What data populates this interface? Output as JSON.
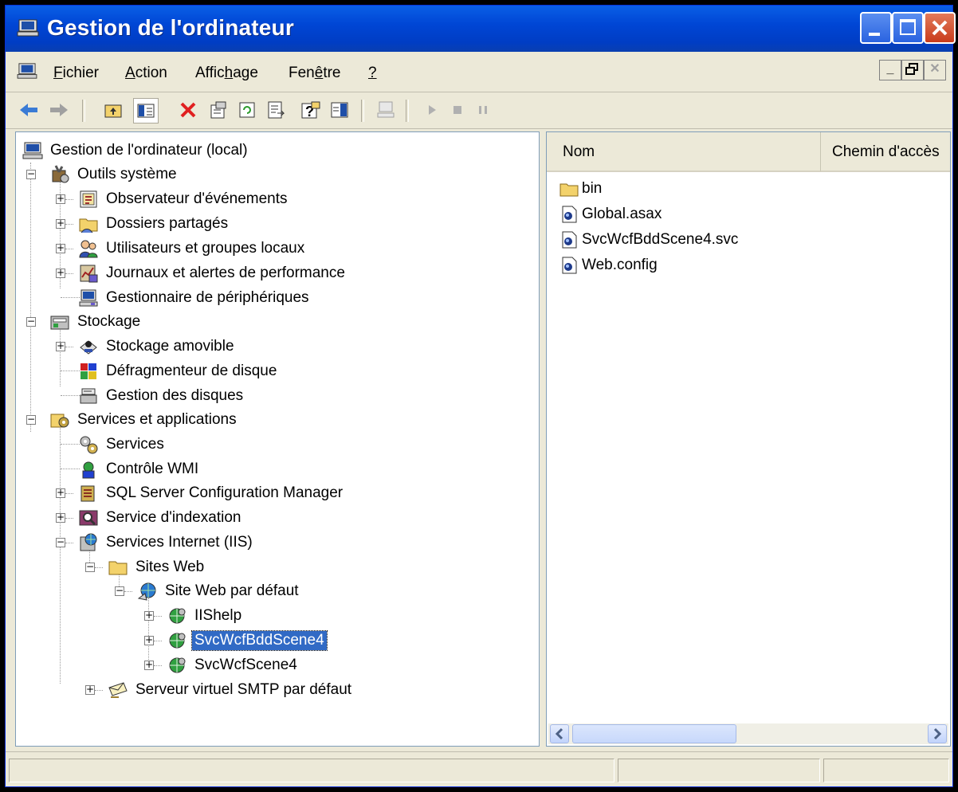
{
  "window": {
    "title": "Gestion de l'ordinateur"
  },
  "menubar": {
    "items": [
      {
        "label": "Fichier",
        "accel": "F",
        "rest": "ichier"
      },
      {
        "label": "Action",
        "accel": "A",
        "rest": "ction"
      },
      {
        "label": "Affichage",
        "pre": "Affic",
        "accel": "h",
        "rest": "age"
      },
      {
        "label": "Fenêtre",
        "pre": "Fen",
        "accel": "ê",
        "rest": "tre"
      },
      {
        "label": "?",
        "accel": "?",
        "rest": ""
      }
    ]
  },
  "tree": {
    "root": "Gestion de l'ordinateur (local)",
    "outils": "Outils système",
    "observateur": "Observateur d'événements",
    "dossiers": "Dossiers partagés",
    "utilisateurs": "Utilisateurs et groupes locaux",
    "journaux": "Journaux et alertes de performance",
    "gestionnaire": "Gestionnaire de périphériques",
    "stockage": "Stockage",
    "stockage_amovible": "Stockage amovible",
    "defrag": "Défragmenteur de disque",
    "gestion_disques": "Gestion des disques",
    "services_apps": "Services et applications",
    "services": "Services",
    "wmi": "Contrôle WMI",
    "sql": "SQL Server Configuration Manager",
    "indexation": "Service d'indexation",
    "iis": "Services Internet (IIS)",
    "sites_web": "Sites Web",
    "site_defaut": "Site Web par défaut",
    "iishelp": "IIShelp",
    "svcbdd": "SvcWcfBddScene4",
    "svcscene": "SvcWcfScene4",
    "smtp": "Serveur virtuel SMTP par défaut"
  },
  "list": {
    "columns": [
      "Nom",
      "Chemin d'accès"
    ],
    "items": [
      {
        "name": "bin",
        "icon": "folder-icon"
      },
      {
        "name": "Global.asax",
        "icon": "asax-file-icon"
      },
      {
        "name": "SvcWcfBddScene4.svc",
        "icon": "svc-file-icon"
      },
      {
        "name": "Web.config",
        "icon": "config-file-icon"
      }
    ]
  },
  "colors": {
    "titlebar": "#0046d5",
    "selection": "#316ac5",
    "chrome": "#ece9d8"
  }
}
